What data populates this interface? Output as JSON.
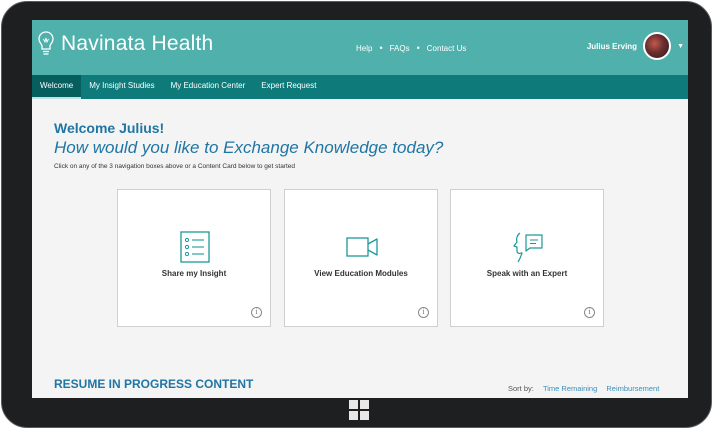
{
  "app": {
    "brand_part1": "Navinata",
    "brand_part2": "Health"
  },
  "header": {
    "links": [
      "Help",
      "FAQs",
      "Contact Us"
    ],
    "separator": "•",
    "user_name": "Julius Erving"
  },
  "nav": {
    "items": [
      {
        "label": "Welcome",
        "active": true
      },
      {
        "label": "My Insight Studies"
      },
      {
        "label": "My Education Center"
      },
      {
        "label": "Expert Request"
      }
    ]
  },
  "main": {
    "welcome": "Welcome Julius!",
    "headline": "How would you like to Exchange Knowledge today?",
    "instruction": "Click on any of the 3 navigation boxes above or a Content Card below to get started"
  },
  "cards": [
    {
      "label": "Share my Insight",
      "icon": "checklist-icon"
    },
    {
      "label": "View Education Modules",
      "icon": "video-camera-icon"
    },
    {
      "label": "Speak with an Expert",
      "icon": "speak-expert-icon"
    }
  ],
  "info_glyph": "i",
  "resume": {
    "title": "RESUME IN PROGRESS CONTENT",
    "sort_label": "Sort by:",
    "sort_options": [
      "Time Remaining",
      "Reimbursement"
    ]
  },
  "colors": {
    "header": "#4fb0ac",
    "nav": "#0e7a7a",
    "heading": "#1f75a4",
    "icon": "#1a9a96"
  }
}
